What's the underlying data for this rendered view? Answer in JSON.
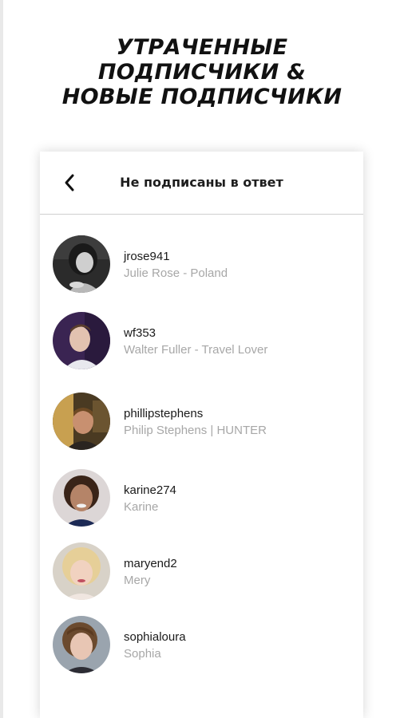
{
  "headline": {
    "line1": "УТРАЧЕННЫЕ",
    "line2": "ПОДПИСЧИКИ &",
    "line3": "НОВЫЕ ПОДПИСЧИКИ"
  },
  "header": {
    "back_icon": "chevron-left-icon",
    "title": "Не подписаны в ответ"
  },
  "users": [
    {
      "username": "jrose941",
      "name": "Julie Rose - Poland"
    },
    {
      "username": "wf353",
      "name": "Walter Fuller - Travel Lover"
    },
    {
      "username": "phillipstephens",
      "name": "Philip Stephens | HUNTER"
    },
    {
      "username": "karine274",
      "name": "Karine"
    },
    {
      "username": "maryend2",
      "name": "Mery"
    },
    {
      "username": "sophialoura",
      "name": "Sophia"
    }
  ],
  "colors": {
    "title_text": "#111111",
    "username_text": "#1a1a1a",
    "secondary_text": "#a7a7a7",
    "divider": "#cfcfcf"
  }
}
